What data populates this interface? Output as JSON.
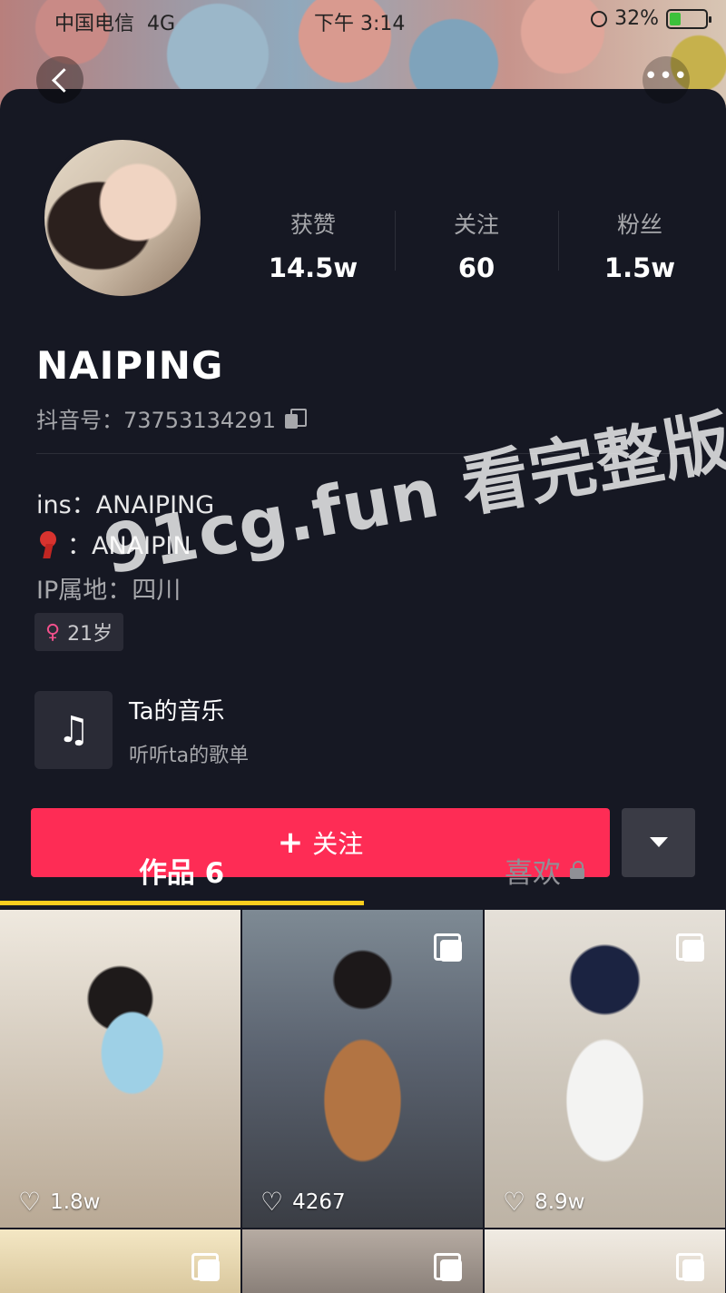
{
  "status_bar": {
    "carrier": "中国电信",
    "network": "4G",
    "time": "下午 3:14",
    "battery": "32%",
    "battery_level": 0.32
  },
  "profile": {
    "stats": [
      {
        "label": "获赞",
        "value": "14.5w"
      },
      {
        "label": "关注",
        "value": "60"
      },
      {
        "label": "粉丝",
        "value": "1.5w"
      }
    ],
    "name": "NAIPING",
    "douyin_id": "抖音号：73753134291",
    "bio": {
      "line1": "ins：ANAIPING",
      "line2": "：ANAIPIN",
      "line3": "IP属地：四川"
    },
    "tag": "21岁",
    "music": {
      "title": "Ta的音乐",
      "subtitle": "听听ta的歌单"
    },
    "follow_label": "关注"
  },
  "tabs": [
    {
      "label": "作品 6"
    },
    {
      "label": "喜欢"
    }
  ],
  "posts": [
    {
      "likes": "1.8w",
      "multi": false
    },
    {
      "likes": "4267",
      "multi": true
    },
    {
      "likes": "8.9w",
      "multi": true
    }
  ],
  "watermark": "91cg.fun 看完整版",
  "colors": {
    "accent": "#fe2c55",
    "tab_indicator": "#facd1e",
    "background": "#161823"
  },
  "icons": [
    "back-icon",
    "more-icon",
    "copy-icon",
    "redbook-icon",
    "female-icon",
    "music-note-icon",
    "plus-icon",
    "chevron-down-icon",
    "lock-icon",
    "heart-icon",
    "multi-image-icon"
  ]
}
